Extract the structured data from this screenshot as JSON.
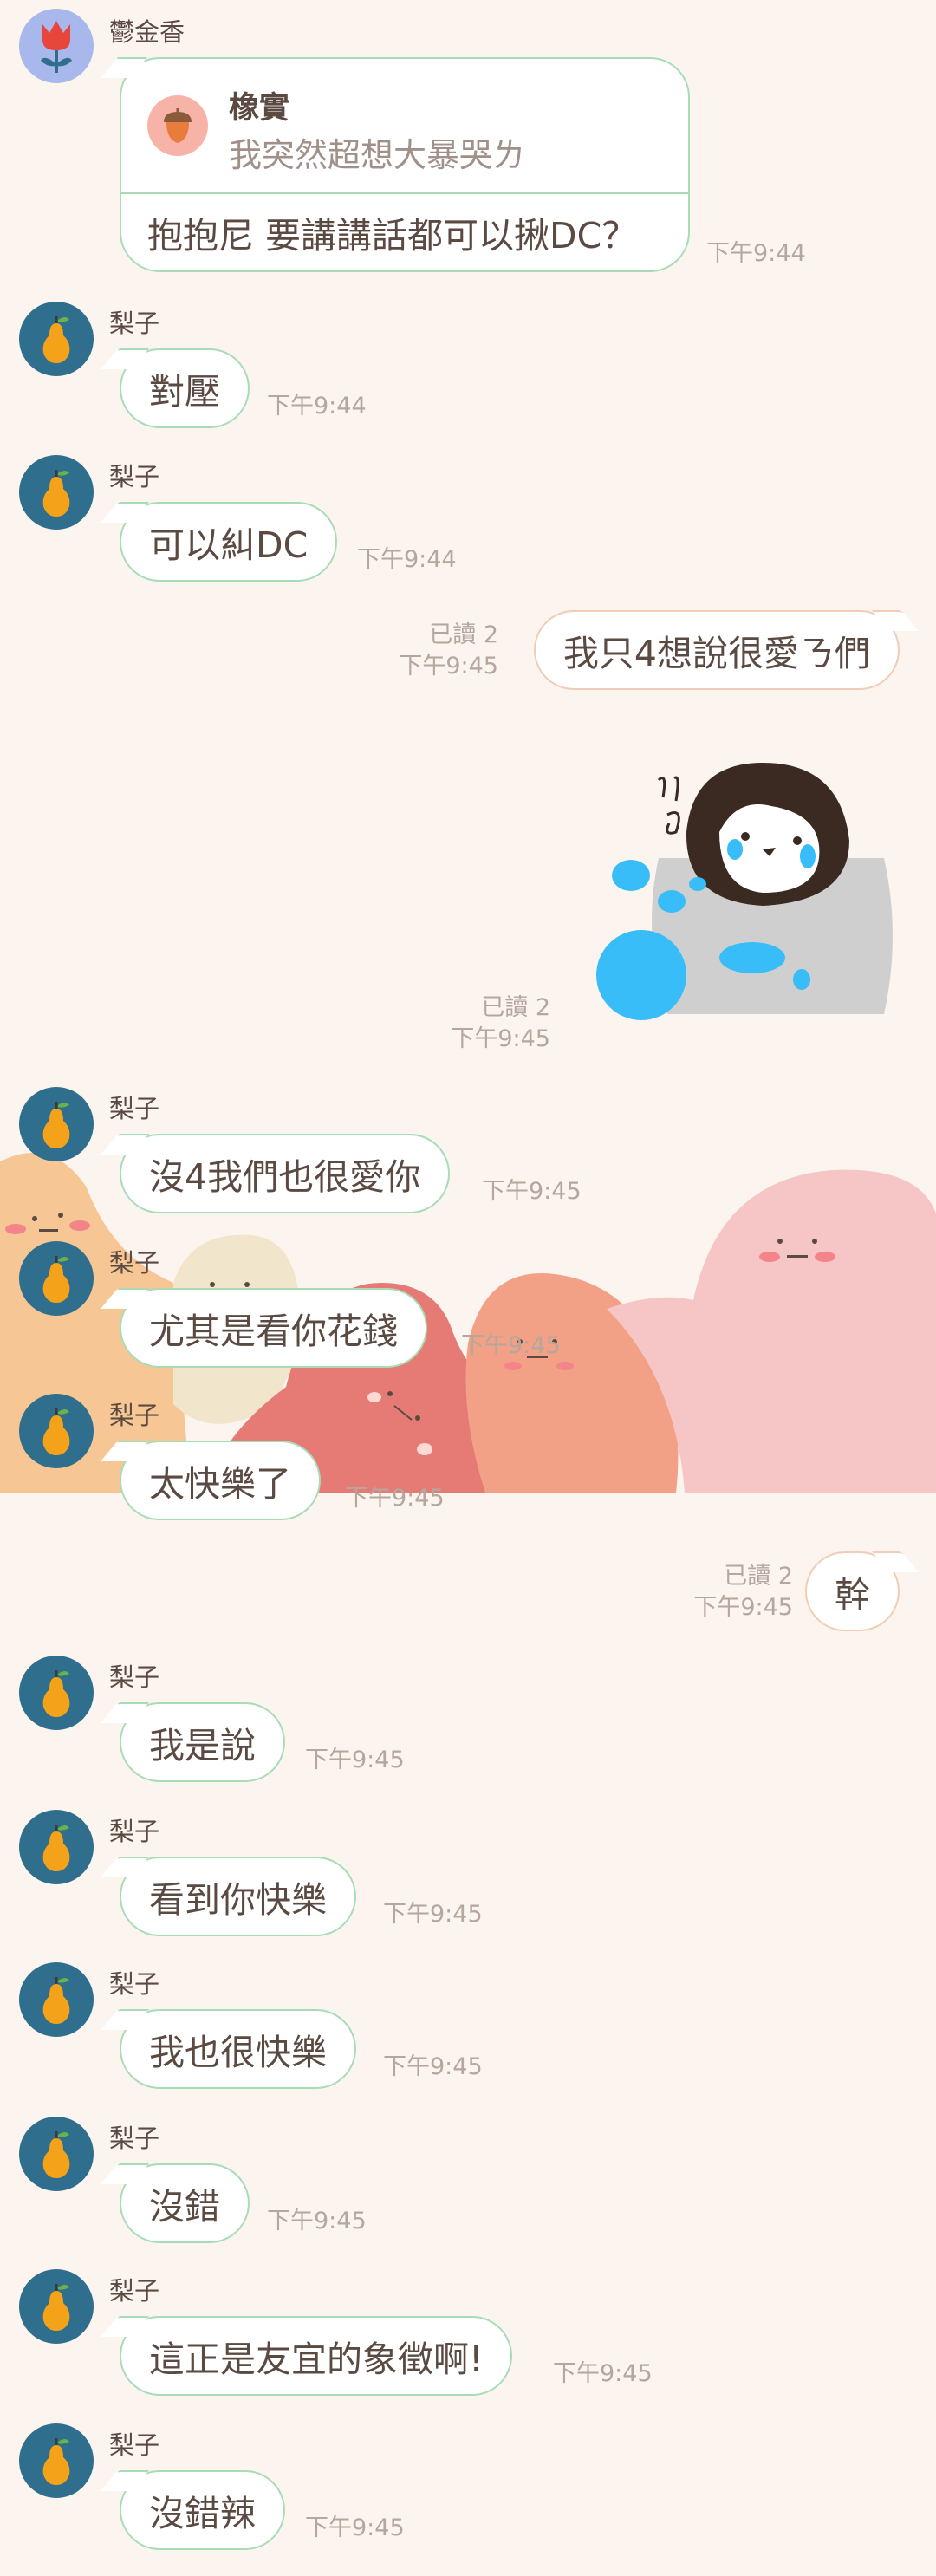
{
  "messages": [
    {
      "sender": "鬱金香",
      "quote_name": "橡實",
      "quote_text": "我突然超想大暴哭ㄌ",
      "text": "抱抱尼 要講講話都可以揪DC？",
      "time": "下午9:44"
    },
    {
      "sender": "梨子",
      "text": "對壓",
      "time": "下午9:44"
    },
    {
      "sender": "梨子",
      "text": "可以糾DC",
      "time": "下午9:44"
    },
    {
      "read": "已讀 2",
      "text": "我只4想說很愛ㄋ們",
      "time": "下午9:45"
    },
    {
      "read": "已讀 2",
      "sticker": "penguin-crying-sticker",
      "time": "下午9:45"
    },
    {
      "sender": "梨子",
      "text": "沒4我們也很愛你",
      "time": "下午9:45"
    },
    {
      "sender": "梨子",
      "text": "尤其是看你花錢",
      "time": "下午9:45"
    },
    {
      "sender": "梨子",
      "text": "太快樂了",
      "time": "下午9:45"
    },
    {
      "read": "已讀 2",
      "text": "幹",
      "time": "下午9:45"
    },
    {
      "sender": "梨子",
      "text": "我是說",
      "time": "下午9:45"
    },
    {
      "sender": "梨子",
      "text": "看到你快樂",
      "time": "下午9:45"
    },
    {
      "sender": "梨子",
      "text": "我也很快樂",
      "time": "下午9:45"
    },
    {
      "sender": "梨子",
      "text": "沒錯",
      "time": "下午9:45"
    },
    {
      "sender": "梨子",
      "text": "這正是友宜的象徵啊!",
      "time": "下午9:45"
    },
    {
      "sender": "梨子",
      "text": "沒錯辣",
      "time": "下午9:45"
    }
  ],
  "colors": {
    "background": "#fbf4ef",
    "bubble_border_incoming": "#a8dcb6",
    "bubble_border_outgoing": "#f0cdb4",
    "avatar_pear": "#2f6e8c",
    "avatar_tulip": "#a9b8ec",
    "time_text": "#b5a69e"
  }
}
